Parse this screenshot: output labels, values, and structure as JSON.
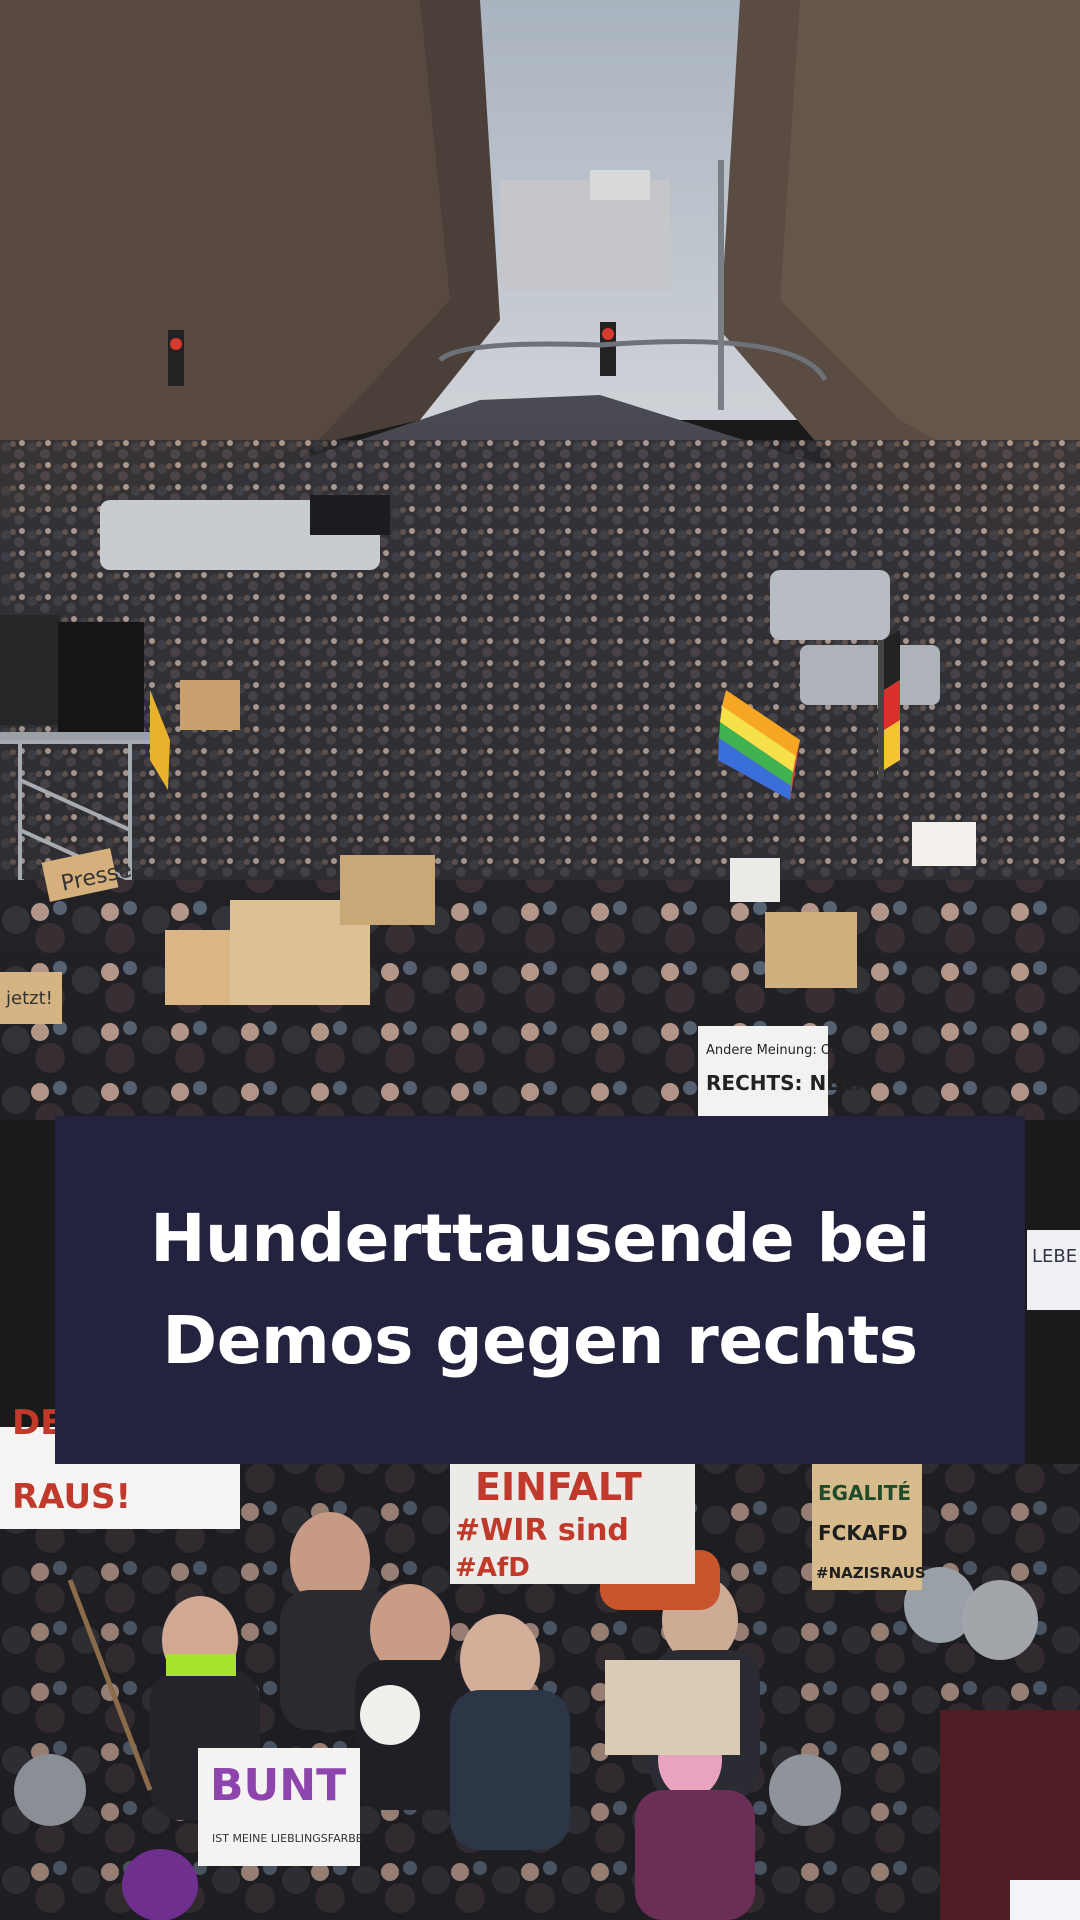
{
  "headline": {
    "line1": "Hunderttausende bei",
    "line2": "Demos gegen rechts",
    "background_color": "#23233f",
    "text_color": "#ffffff"
  },
  "photo": {
    "signs": {
      "presse": "Presse",
      "andere_meinung": "Andere Meinung: OK",
      "rechts_nee": "RECHTS: NEE!!",
      "einfalt": "EINFALT",
      "wir_sind": "#WIR sind",
      "afd": "#AfD",
      "egalite": "EGALITÉ",
      "fck_afd": "FCKAFD",
      "nazis_raus": "#NAZISRAUS",
      "raus": "RAUS!",
      "bunt": "BUNT",
      "bunt_sub": "IST MEINE LIEBLINGSFARBE",
      "lebe": "LEBE",
      "jetzt": "jetzt!"
    }
  }
}
